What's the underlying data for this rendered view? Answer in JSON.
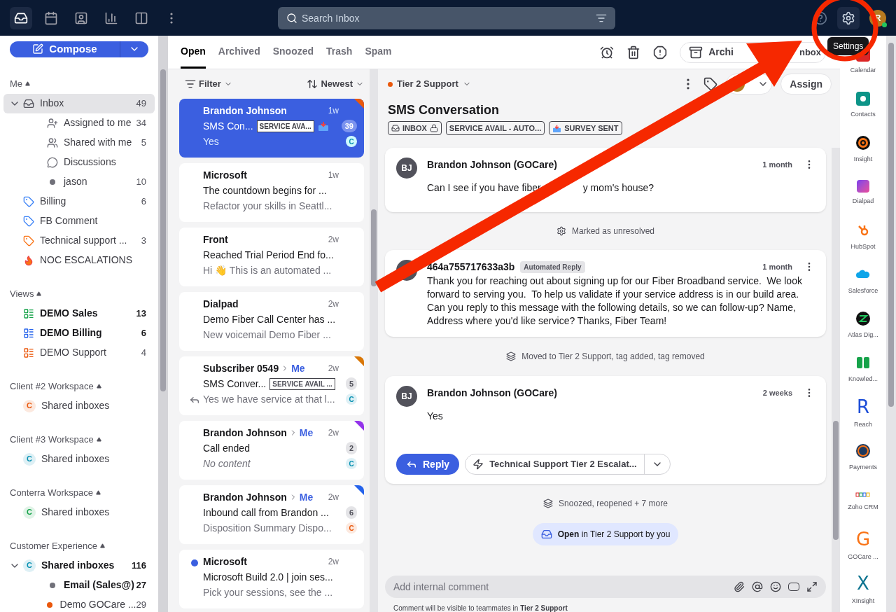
{
  "topbar": {
    "nav": [
      {
        "kind": "inbox",
        "selected": true
      },
      {
        "kind": "calendar",
        "selected": false
      },
      {
        "kind": "contacts",
        "selected": false
      },
      {
        "kind": "analytics",
        "selected": false
      },
      {
        "kind": "split",
        "selected": false
      },
      {
        "kind": "more",
        "selected": false
      }
    ],
    "search": {
      "placeholder": "Search Inbox"
    },
    "tooltip": "Settings",
    "avatar": "R"
  },
  "sidebar": {
    "compose": "Compose",
    "sections": [
      {
        "title": "Me",
        "items": [
          {
            "kind": "inbox",
            "label": "Inbox",
            "count": "49",
            "selected": true,
            "expanded": true,
            "children": [
              {
                "kind": "assigned",
                "label": "Assigned to me",
                "count": "34"
              },
              {
                "kind": "shared",
                "label": "Shared with me",
                "count": "5"
              },
              {
                "kind": "discussion",
                "label": "Discussions"
              },
              {
                "kind": "dot",
                "label": "jason",
                "count": "10",
                "color": "#71717a"
              }
            ]
          },
          {
            "kind": "tag",
            "label": "Billing",
            "count": "6",
            "color": "#3b82f6"
          },
          {
            "kind": "tag",
            "label": "FB Comment",
            "color": "#3b82f6"
          },
          {
            "kind": "tag",
            "label": "Technical support ...",
            "count": "3",
            "color": "#f97316"
          },
          {
            "kind": "fire",
            "label": "NOC ESCALATIONS"
          }
        ]
      },
      {
        "title": "Views",
        "items": [
          {
            "kind": "view",
            "label": "DEMO Sales",
            "count": "13",
            "bold": true,
            "color": "#16a34a"
          },
          {
            "kind": "view",
            "label": "DEMO Billing",
            "count": "6",
            "bold": true,
            "color": "#2563eb"
          },
          {
            "kind": "view",
            "label": "DEMO Support",
            "count": "4",
            "bold": false,
            "color": "#ea580c"
          }
        ]
      },
      {
        "title": "Client #2 Workspace",
        "items": [
          {
            "kind": "workspace",
            "label": "Shared inboxes",
            "letter": "C",
            "color": "#ea580c"
          }
        ]
      },
      {
        "title": "Client #3 Workspace",
        "items": [
          {
            "kind": "workspace",
            "label": "Shared inboxes",
            "letter": "C",
            "color": "#0891b2"
          }
        ]
      },
      {
        "title": "Conterra Workspace",
        "items": [
          {
            "kind": "workspace",
            "label": "Shared inboxes",
            "letter": "C",
            "color": "#16a34a"
          }
        ]
      },
      {
        "title": "Customer Experience",
        "items": [
          {
            "kind": "workspace",
            "label": "Shared inboxes",
            "letter": "C",
            "color": "#0891b2",
            "count": "116",
            "bold": true,
            "expanded": true,
            "children": [
              {
                "kind": "dot",
                "label": "Email (Sales@)",
                "count": "27",
                "bold": true,
                "color": "#71717a"
              },
              {
                "kind": "dot",
                "label": "Demo GOCare ...",
                "count": "29",
                "bold": false,
                "color": "#ea580c"
              }
            ]
          }
        ]
      }
    ]
  },
  "tabs": [
    {
      "label": "Open",
      "selected": true
    },
    {
      "label": "Archived",
      "selected": false
    },
    {
      "label": "Snoozed",
      "selected": false
    },
    {
      "label": "Trash",
      "selected": false
    },
    {
      "label": "Spam",
      "selected": false
    }
  ],
  "toolbar": {
    "archive": [
      "Archi",
      "nbox"
    ],
    "assign": "Assign"
  },
  "list": {
    "filter": "Filter",
    "sort": "Newest",
    "inbox": {
      "label": "Tier 2 Support",
      "color": "#ea580c"
    }
  },
  "conversations": [
    {
      "sender": "Brandon Johnson",
      "time": "1w",
      "subject": "SMS Con...",
      "tag": "SERVICE AVA...",
      "survey": true,
      "count": "39",
      "preview": "Yes",
      "avatar": {
        "letter": "C",
        "color": "#0891b2"
      },
      "color": "#ea580c",
      "selected": true
    },
    {
      "sender": "Microsoft",
      "time": "1w",
      "subject": "The countdown begins for ...",
      "preview": "Refactor your skills in Seattl...",
      "selected": false
    },
    {
      "sender": "Front",
      "time": "2w",
      "subject": "Reached Trial Period End fo...",
      "preview": "Hi 👋 This is an automated ...",
      "selected": false
    },
    {
      "sender": "Dialpad",
      "time": "2w",
      "subject": "Demo Fiber Call Center has ...",
      "preview": "New voicemail Demo Fiber ...",
      "selected": false
    },
    {
      "sender": "Subscriber 0549",
      "to": "Me",
      "time": "2w",
      "subject": "SMS Conver...",
      "tag": "SERVICE AVAIL ...",
      "count": "5",
      "preview": "Yes we have service at that l...",
      "replied": true,
      "avatar": {
        "letter": "C",
        "color": "#0891b2"
      },
      "color": "#d97706",
      "selected": false
    },
    {
      "sender": "Brandon Johnson",
      "to": "Me",
      "time": "2w",
      "subject": "Call ended",
      "count": "2",
      "preview": "No content",
      "italic": true,
      "avatar": {
        "letter": "C",
        "color": "#0891b2"
      },
      "color": "#9333ea",
      "selected": false
    },
    {
      "sender": "Brandon Johnson",
      "to": "Me",
      "time": "2w",
      "subject": "Inbound call from Brandon ...",
      "count": "6",
      "preview": "Disposition Summary Dispo...",
      "avatar": {
        "letter": "C",
        "color": "#ea580c"
      },
      "color": "#2563eb",
      "selected": false
    },
    {
      "sender": "Microsoft",
      "time": "2w",
      "subject": "Microsoft Build 2.0 | join ses...",
      "preview": "Pick your sessions, see the ...",
      "unread": true,
      "selected": false
    }
  ],
  "conversation": {
    "title": "SMS Conversation",
    "tags": [
      {
        "kind": "inbox",
        "label": "INBOX"
      },
      {
        "kind": "plain",
        "label": "SERVICE AVAIL - AUTO..."
      },
      {
        "kind": "survey",
        "label": "SURVEY SENT"
      }
    ],
    "thread": [
      {
        "kind": "message",
        "initials": "BJ",
        "author": "Brandon Johnson (GOCare)",
        "time": "1 month",
        "body": [
          "Can I see if you have fiber",
          "y mom's house?"
        ]
      },
      {
        "kind": "marked",
        "text": "Marked as unresolved"
      },
      {
        "kind": "message",
        "author": "464a755717633a3b",
        "badge": "Automated Reply",
        "time": "1 month",
        "body": [
          "Thank you for reaching out about signing up for our Fiber Broadband service.  We look forward to serving you.  To help us validate if your service address is in our build area.  Can you reply to this message with the following details, so we can follow-up? Name, Address where you'd like service? Thanks, Fiber Team!"
        ]
      },
      {
        "kind": "moved",
        "text": "Moved to Tier 2 Support, tag added, tag removed"
      },
      {
        "kind": "message",
        "initials": "BJ",
        "author": "Brandon Johnson (GOCare)",
        "time": "2 weeks",
        "body": [
          "Yes"
        ],
        "reply": "Reply",
        "macro": "Technical Support Tier 2 Escalat..."
      },
      {
        "kind": "moved",
        "text": "Snoozed, reopened + 7 more"
      },
      {
        "kind": "status",
        "text": "**Open** in Tier 2 Support by you"
      }
    ],
    "comment": {
      "placeholder": "Add internal comment",
      "note": "Comment will be visible to teammates in **Tier 2 Support**"
    }
  },
  "apps": [
    {
      "kind": "calendar",
      "label": "Calendar"
    },
    {
      "kind": "contacts",
      "label": "Contacts"
    },
    {
      "kind": "insight",
      "label": "Insight"
    },
    {
      "kind": "dialpad",
      "label": "Dialpad"
    },
    {
      "kind": "hubspot",
      "label": "HubSpot"
    },
    {
      "kind": "salesforce",
      "label": "Salesforce"
    },
    {
      "kind": "atlas",
      "label": "Atlas Dig..."
    },
    {
      "kind": "knowledge",
      "label": "Knowled..."
    },
    {
      "kind": "letter",
      "letter": "R",
      "color": "#1d4ed8",
      "label": "Reach"
    },
    {
      "kind": "payments",
      "label": "Payments"
    },
    {
      "kind": "zoho",
      "label": "Zoho CRM"
    },
    {
      "kind": "letter",
      "letter": "G",
      "color": "#f97316",
      "label": "GOCare ..."
    },
    {
      "kind": "letter",
      "letter": "X",
      "color": "#0e7490",
      "label": "XInsight"
    }
  ],
  "annotation": {
    "arrow": true,
    "circle": true
  }
}
